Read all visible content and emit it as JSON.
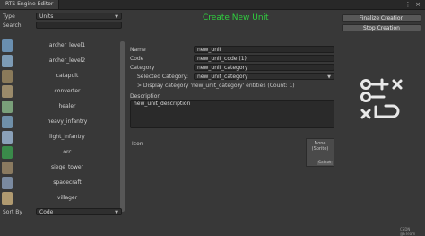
{
  "window": {
    "tab_title": "RTS Engine Editor"
  },
  "left_panel": {
    "type_label": "Type",
    "type_value": "Units",
    "search_label": "Search",
    "search_value": "",
    "units": [
      {
        "label": "archer_level1",
        "icon": "archer-icon"
      },
      {
        "label": "archer_level2",
        "icon": "archer-icon"
      },
      {
        "label": "catapult",
        "icon": "catapult-icon"
      },
      {
        "label": "converter",
        "icon": "converter-icon"
      },
      {
        "label": "healer",
        "icon": "healer-icon"
      },
      {
        "label": "heavy_infantry",
        "icon": "heavy-infantry-icon"
      },
      {
        "label": "light_infantry",
        "icon": "light-infantry-icon"
      },
      {
        "label": "orc",
        "icon": "orc-icon"
      },
      {
        "label": "siege_tower",
        "icon": "siege-tower-icon"
      },
      {
        "label": "spacecraft",
        "icon": "spacecraft-icon"
      },
      {
        "label": "villager",
        "icon": "villager-icon"
      }
    ],
    "sort_label": "Sort By",
    "sort_value": "Code"
  },
  "form": {
    "heading": "Create New Unit",
    "name_label": "Name",
    "name_value": "new_unit",
    "code_label": "Code",
    "code_value": "new_unit_code (1)",
    "category_label": "Category",
    "category_value": "new_unit_category",
    "selected_category_label": "Selected Category:",
    "selected_category_value": "new_unit_category",
    "display_toggle": "> Display category 'new_unit_category' entities (Count: 1)",
    "description_label": "Description",
    "description_value": "new_unit_description",
    "icon_label": "Icon",
    "sprite_none": "None",
    "sprite_type": "(Sprite)",
    "sprite_select": "Select"
  },
  "right_panel": {
    "finalize_label": "Finalize Creation",
    "stop_label": "Stop Creation",
    "watermark": "CSDN @ETeam"
  },
  "colors": {
    "heading": "#2fcf3f",
    "background": "#383838"
  }
}
